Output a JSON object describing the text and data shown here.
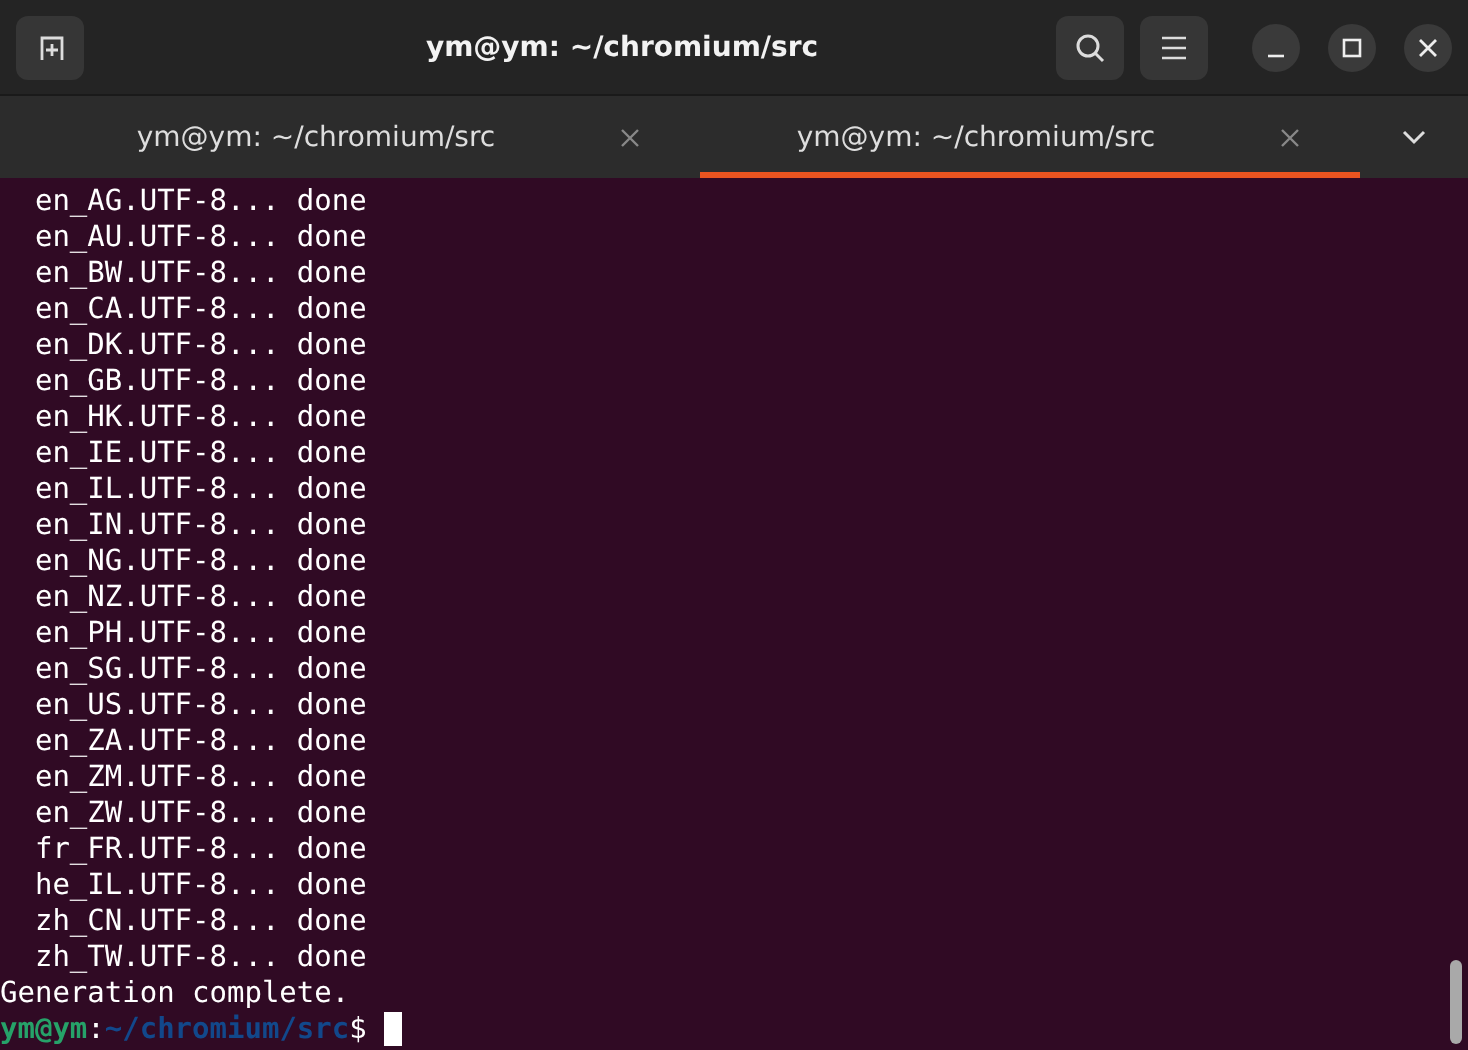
{
  "window": {
    "title": "ym@ym: ~/chromium/src"
  },
  "tabs": [
    {
      "label": "ym@ym: ~/chromium/src",
      "selected": false
    },
    {
      "label": "ym@ym: ~/chromium/src",
      "selected": true
    }
  ],
  "terminal": {
    "lines": [
      "  en_AG.UTF-8... done",
      "  en_AU.UTF-8... done",
      "  en_BW.UTF-8... done",
      "  en_CA.UTF-8... done",
      "  en_DK.UTF-8... done",
      "  en_GB.UTF-8... done",
      "  en_HK.UTF-8... done",
      "  en_IE.UTF-8... done",
      "  en_IL.UTF-8... done",
      "  en_IN.UTF-8... done",
      "  en_NG.UTF-8... done",
      "  en_NZ.UTF-8... done",
      "  en_PH.UTF-8... done",
      "  en_SG.UTF-8... done",
      "  en_US.UTF-8... done",
      "  en_ZA.UTF-8... done",
      "  en_ZM.UTF-8... done",
      "  en_ZW.UTF-8... done",
      "  fr_FR.UTF-8... done",
      "  he_IL.UTF-8... done",
      "  zh_CN.UTF-8... done",
      "  zh_TW.UTF-8... done",
      "Generation complete."
    ],
    "prompt": {
      "user": "ym@ym",
      "separator": ":",
      "path": "~/chromium/src",
      "symbol": "$"
    }
  }
}
